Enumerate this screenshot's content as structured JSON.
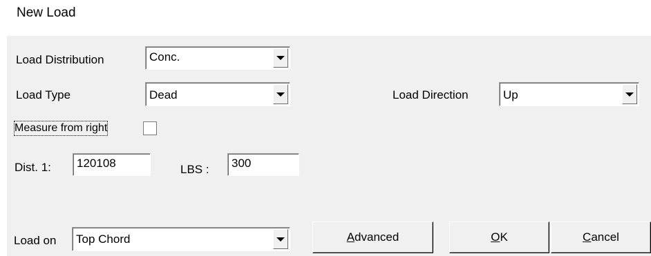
{
  "window": {
    "title": "New Load"
  },
  "load_distribution": {
    "label": "Load Distribution",
    "value": "Conc."
  },
  "load_type": {
    "label": "Load Type",
    "value": "Dead"
  },
  "load_direction": {
    "label": "Load Direction",
    "value": "Up"
  },
  "measure_from_right": {
    "label": "Measure from right",
    "checked": false
  },
  "dist1": {
    "label": "Dist. 1:",
    "value": "120108"
  },
  "lbs": {
    "label": "LBS :",
    "value": "300"
  },
  "load_on": {
    "label": "Load on",
    "value": "Top Chord"
  },
  "buttons": {
    "advanced": {
      "mnemonic": "A",
      "rest": "dvanced"
    },
    "ok": {
      "mnemonic": "O",
      "rest": "K"
    },
    "cancel": {
      "mnemonic": "C",
      "rest": "ancel"
    }
  },
  "icons": {
    "dropdown": "chevron-down-icon"
  }
}
